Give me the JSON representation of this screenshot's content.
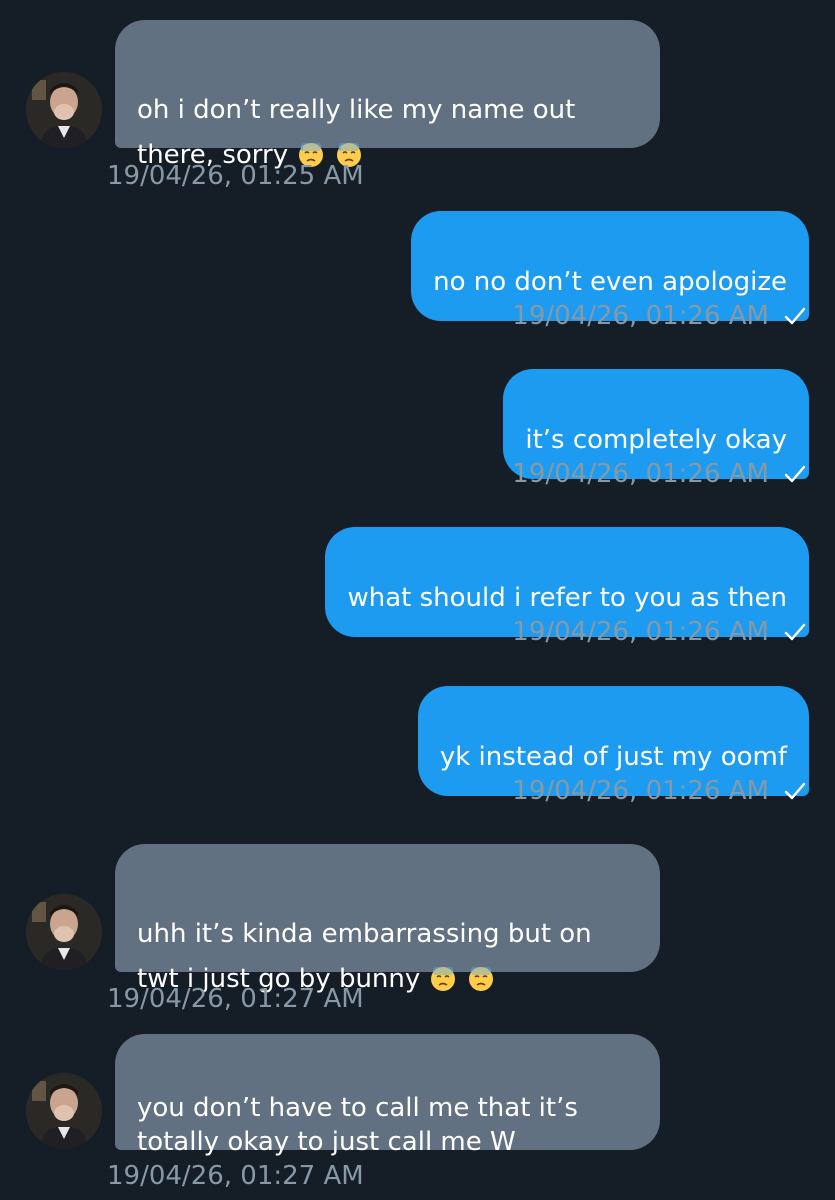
{
  "messages": [
    {
      "text": "oh i don’t really like my name out\nthere, sorry",
      "emoji": [
        "sweat-emoji",
        "sweat-emoji"
      ],
      "timestamp": "19/04/26, 01:25 AM"
    },
    {
      "text": "no no don’t even apologize",
      "timestamp": "19/04/26, 01:26 AM"
    },
    {
      "text": "it’s completely okay",
      "timestamp": "19/04/26, 01:26 AM"
    },
    {
      "text": "what should i refer to you as then",
      "timestamp": "19/04/26, 01:26 AM"
    },
    {
      "text": "yk instead of just my oomf",
      "timestamp": "19/04/26, 01:26 AM"
    },
    {
      "text": "uhh it’s kinda embarrassing but on\ntwt i just go by bunny",
      "emoji": [
        "sweat-emoji",
        "sweat-emoji"
      ],
      "timestamp": "19/04/26, 01:27 AM"
    },
    {
      "text": "you don’t have to call me that it’s\ntotally okay to just call me W",
      "timestamp": "19/04/26, 01:27 AM"
    }
  ],
  "colors": {
    "background": "#151d27",
    "incoming_bubble": "#627181",
    "outgoing_bubble": "#1d9bf0",
    "timestamp": "#8899a6"
  },
  "icons": [
    "avatar",
    "sent-check-icon",
    "sweat-emoji"
  ]
}
